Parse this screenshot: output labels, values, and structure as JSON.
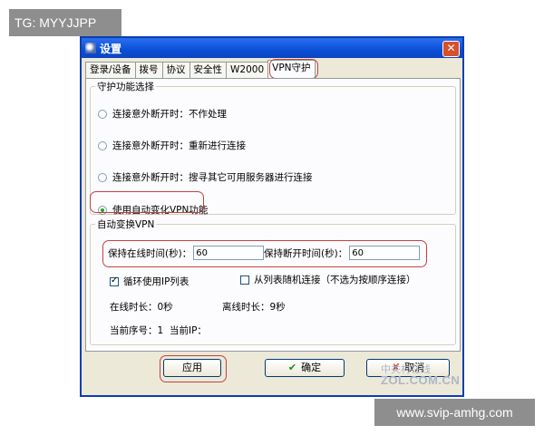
{
  "watermarks": {
    "top": "TG: MYYJJPP",
    "bottom": "www.svip-amhg.com"
  },
  "window": {
    "title": "设置",
    "close_symbol": "✕"
  },
  "tabs": [
    {
      "label": "登录/设备",
      "active": false
    },
    {
      "label": "拨号",
      "active": false
    },
    {
      "label": "协议",
      "active": false
    },
    {
      "label": "安全性",
      "active": false
    },
    {
      "label": "W2000",
      "active": false
    },
    {
      "label": "VPN守护",
      "active": true
    }
  ],
  "protect_group": {
    "legend": "守护功能选择",
    "options": [
      {
        "label": "连接意外断开时：不作处理",
        "selected": false
      },
      {
        "label": "连接意外断开时：重新进行连接",
        "selected": false
      },
      {
        "label": "连接意外断开时：搜寻其它可用服务器进行连接",
        "selected": false
      },
      {
        "label": "使用自动变化VPN功能",
        "selected": true
      }
    ]
  },
  "auto_group": {
    "legend": "自动变换VPN",
    "online_time_label": "保持在线时间(秒)：",
    "online_time_value": "60",
    "offline_time_label": "保持断开时间(秒)：",
    "offline_time_value": "60",
    "loop_ip_label": "循环使用IP列表",
    "loop_ip_checked": true,
    "random_label": "从列表随机连接（不选为按顺序连接）",
    "random_checked": false,
    "online_duration": "在线时长：0秒",
    "offline_duration": "离线时长：9秒",
    "current_index": "当前序号：1",
    "current_ip": "当前IP："
  },
  "buttons": {
    "apply": "应用",
    "ok": "确定",
    "ok_icon": "✔",
    "cancel": "取消",
    "cancel_icon": "✘"
  },
  "site_watermark": {
    "line1": "中关村在线",
    "line2": "ZOL.COM.CN"
  },
  "colors": {
    "highlight": "#c84040",
    "titlebar": "#0a4fd6",
    "dialog_bg": "#ece9d8"
  }
}
